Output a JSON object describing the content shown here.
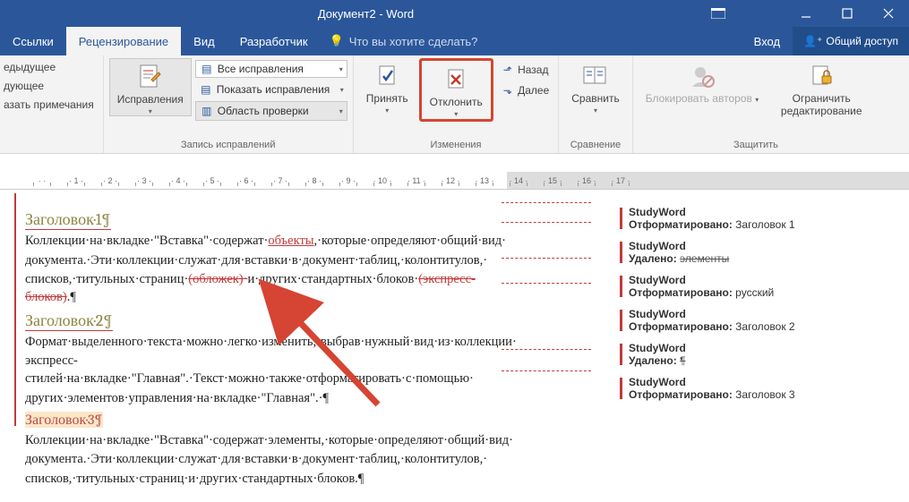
{
  "titlebar": {
    "title": "Документ2 - Word"
  },
  "tabs": {
    "items": [
      "Ссылки",
      "Рецензирование",
      "Вид",
      "Разработчик"
    ],
    "tell_me": "Что вы хотите сделать?",
    "login": "Вход",
    "share": "Общий доступ"
  },
  "ribbon": {
    "comments": {
      "prev": "едыдущее",
      "next": "дующее",
      "show": "азать примечания"
    },
    "tracking": {
      "btn": "Исправления",
      "dd1": "Все исправления",
      "dd2": "Показать исправления",
      "dd3": "Область проверки",
      "group": "Запись исправлений"
    },
    "changes": {
      "accept": "Принять",
      "reject": "Отклонить",
      "prev": "Назад",
      "next": "Далее",
      "group": "Изменения"
    },
    "compare": {
      "btn": "Сравнить",
      "group": "Сравнение"
    },
    "protect": {
      "block": "Блокировать авторов",
      "restrict": "Ограничить редактирование",
      "group": "Защитить"
    }
  },
  "ruler": [
    "",
    "1",
    "2",
    "3",
    "4",
    "5",
    "6",
    "7",
    "8",
    "9",
    "10",
    "11",
    "12",
    "13",
    "14",
    "15",
    "16",
    "17"
  ],
  "doc": {
    "h1": "Заголовок·1¶",
    "p1a": "Коллекции·на·вкладке·\"Вставка\"·содержат·",
    "p1_ins": "объекты",
    "p1b": ",·которые·определяют·общий·вид·",
    "p2a": "документа.·Эти·коллекции·служат·для·вставки·в·документ·таблиц,·колонтитулов,·",
    "p3a": "списков,·титульных·страниц·",
    "p3_del": "(обложек)·",
    "p3b": "и·других·стандартных·блоков·",
    "p3_del2": "(экспресс-блоков)",
    "p3c": ".¶",
    "h2": "Заголовок·2¶",
    "p4": "Формат·выделенного·текста·можно·легко·изменить,·выбрав·нужный·вид·из·коллекции·",
    "p5": "экспресс-стилей·на·вкладке·\"Главная\".·Текст·можно·также·отформатировать·с·помощью·",
    "p6": "других·элементов·управления·на·вкладке·\"Главная\".·¶",
    "h3": "Заголовок·3¶",
    "p7": "Коллекции·на·вкладке·\"Вставка\"·содержат·элементы,·которые·определяют·общий·вид·",
    "p8": "документа.·Эти·коллекции·служат·для·вставки·в·документ·таблиц,·колонтитулов,·",
    "p9": "списков,·титульных·страниц·и·других·стандартных·блоков.¶"
  },
  "balloons": [
    {
      "author": "StudyWord",
      "type": "fmt",
      "label": "Отформатировано:",
      "content": "Заголовок 1"
    },
    {
      "author": "StudyWord",
      "type": "del",
      "label": "Удалено:",
      "content": "элементы"
    },
    {
      "author": "StudyWord",
      "type": "fmt",
      "label": "Отформатировано:",
      "content": "русский"
    },
    {
      "author": "StudyWord",
      "type": "fmt",
      "label": "Отформатировано:",
      "content": "Заголовок 2"
    },
    {
      "author": "StudyWord",
      "type": "del",
      "label": "Удалено:",
      "content": "¶"
    },
    {
      "author": "StudyWord",
      "type": "fmt",
      "label": "Отформатировано:",
      "content": "Заголовок 3"
    }
  ]
}
